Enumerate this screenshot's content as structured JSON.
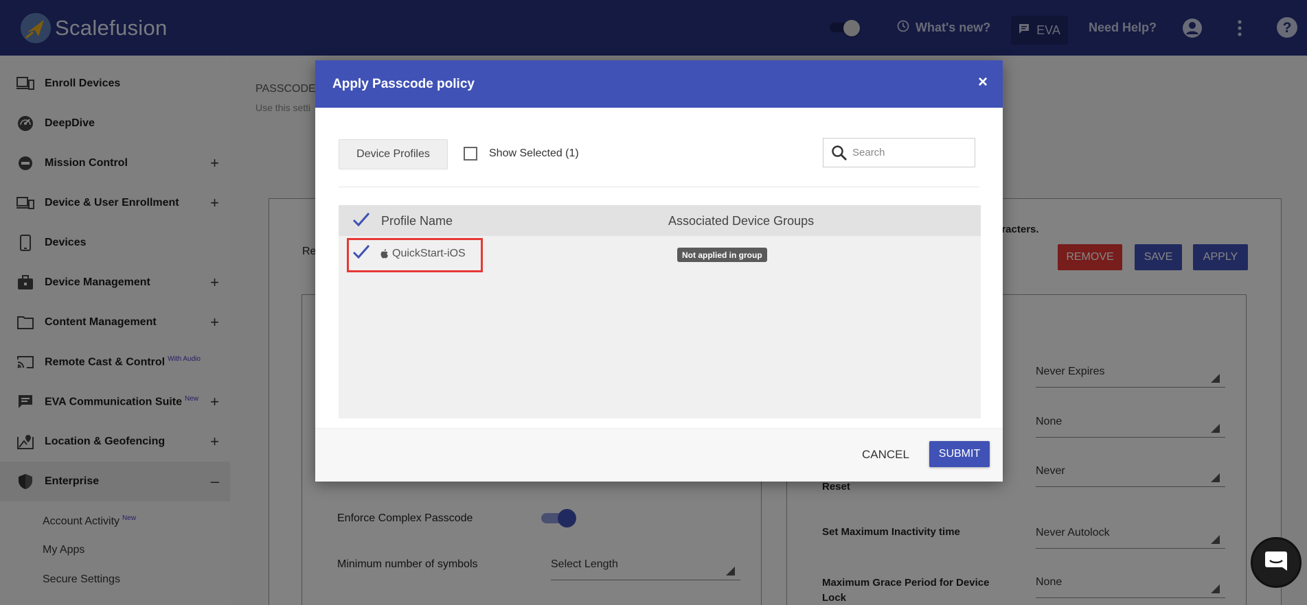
{
  "header": {
    "brand": "Scalefusion",
    "whats_new": "What's new?",
    "eva": "EVA",
    "need_help": "Need Help?"
  },
  "sidebar": {
    "items": [
      {
        "label": "Enroll Devices",
        "icon": "enroll-icon",
        "expandable": false
      },
      {
        "label": "DeepDive",
        "icon": "gauge-icon",
        "expandable": false
      },
      {
        "label": "Mission Control",
        "icon": "mission-icon",
        "expandable": true
      },
      {
        "label": "Device & User Enrollment",
        "icon": "devices-icon",
        "expandable": true
      },
      {
        "label": "Devices",
        "icon": "phone-icon",
        "expandable": false
      },
      {
        "label": "Device Management",
        "icon": "briefcase-icon",
        "expandable": true
      },
      {
        "label": "Content Management",
        "icon": "folder-icon",
        "expandable": true
      },
      {
        "label": "Remote Cast & Control",
        "sup": "With Audio",
        "icon": "cast-icon",
        "expandable": false
      },
      {
        "label": "EVA Communication Suite",
        "sup": "New",
        "icon": "chat-icon",
        "expandable": true
      },
      {
        "label": "Location & Geofencing",
        "icon": "map-icon",
        "expandable": true
      },
      {
        "label": "Enterprise",
        "icon": "shield-icon",
        "expandable": true,
        "expanded": true
      }
    ],
    "sub_items": [
      {
        "label": "Account Activity",
        "sup": "New"
      },
      {
        "label": "My Apps"
      },
      {
        "label": "Secure Settings"
      }
    ],
    "expand_symbol": "+",
    "collapse_symbol": "–"
  },
  "background": {
    "title": "PASSCODE",
    "subtitle": "Use this setti",
    "re_label": "Re",
    "chars_text": "aracters.",
    "remove": "REMOVE",
    "save": "SAVE",
    "apply": "APPLY",
    "enforce_complex": "Enforce Complex Passcode",
    "min_symbols": "Minimum number of symbols",
    "select_length": "Select Length",
    "never_expires": "Never Expires",
    "none1": "None",
    "reset": "Reset",
    "never": "Never",
    "max_inactivity": "Set Maximum Inactivity time",
    "never_autolock": "Never Autolock",
    "max_grace": "Maximum Grace Period for Device Lock",
    "none2": "None"
  },
  "modal": {
    "title": "Apply Passcode policy",
    "close": "×",
    "tab": "Device Profiles",
    "show_selected": "Show Selected (1)",
    "search_placeholder": "Search",
    "col_profile": "Profile Name",
    "col_groups": "Associated Device Groups",
    "row": {
      "name": "QuickStart-iOS",
      "status": "Not applied in group"
    },
    "cancel": "CANCEL",
    "submit": "SUBMIT"
  },
  "colors": {
    "header_bg": "#27327e",
    "modal_header": "#4052b5",
    "remove": "#e53935",
    "primary": "#4052b5"
  }
}
